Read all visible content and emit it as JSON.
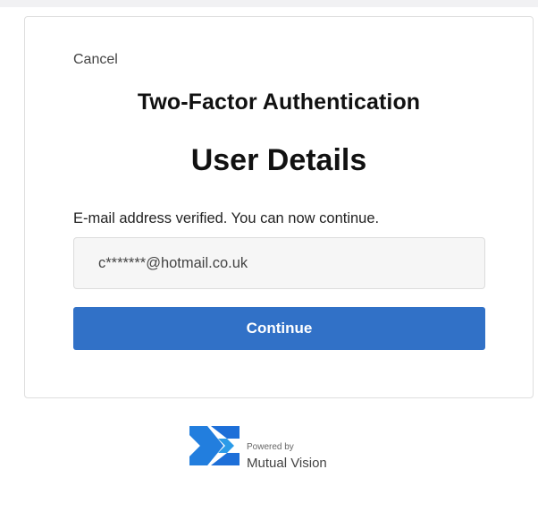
{
  "card": {
    "cancel_label": "Cancel",
    "heading": "Two-Factor Authentication",
    "title": "User Details",
    "status_message": "E-mail address verified. You can now continue.",
    "email_value": "c*******@hotmail.co.uk",
    "continue_label": "Continue"
  },
  "footer": {
    "powered_by": "Powered by",
    "brand_name": "Mutual Vision",
    "logo_icon": "mutual-vision-logo"
  },
  "colors": {
    "accent": "#3171c7",
    "logo_primary": "#1d6fd8",
    "logo_secondary": "#2b9be8",
    "background": "#f1f1f3",
    "card": "#ffffff"
  }
}
